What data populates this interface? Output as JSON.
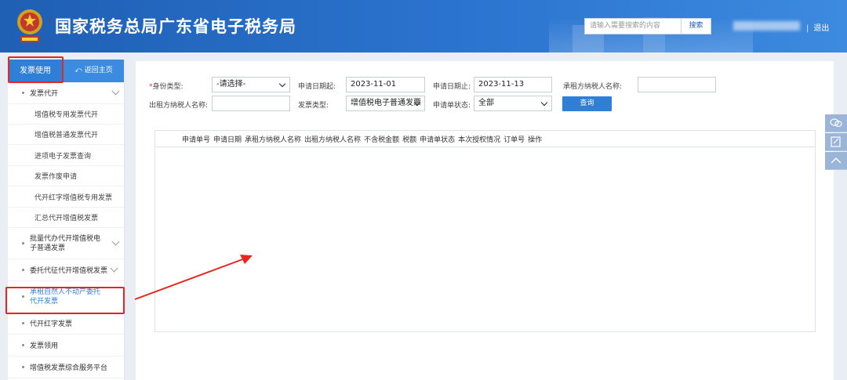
{
  "header": {
    "title": "国家税务总局广东省电子税务局",
    "search_placeholder": "请输入需要搜索的内容",
    "search_button": "搜索",
    "separator": "|",
    "logout": "退出"
  },
  "sidebar": {
    "tab_label": "发票使用",
    "home_label": "返回主页",
    "items": [
      {
        "label": "发票代开",
        "level": "top",
        "chevron": true
      },
      {
        "label": "增值税专用发票代开",
        "level": "sub"
      },
      {
        "label": "增值税普通发票代开",
        "level": "sub"
      },
      {
        "label": "进项电子发票查询",
        "level": "sub"
      },
      {
        "label": "发票作废申请",
        "level": "sub"
      },
      {
        "label": "代开红字增值税专用发票",
        "level": "sub"
      },
      {
        "label": "汇总代开增值税发票",
        "level": "sub"
      },
      {
        "label": "批量代办代开增值税电子普通发票",
        "level": "top",
        "chevron": true
      },
      {
        "label": "委托代征代开增值税发票",
        "level": "top",
        "chevron": true
      },
      {
        "label": "承租自然人不动产委托代开发票",
        "level": "top",
        "active": true
      },
      {
        "label": "代开红字发票",
        "level": "top"
      },
      {
        "label": "发票领用",
        "level": "top"
      },
      {
        "label": "增值税发票综合服务平台",
        "level": "top"
      }
    ]
  },
  "form": {
    "identity_required": "*",
    "identity_label": "身份类型:",
    "identity_value": "-请选择-",
    "apply_start_label": "申请日期起:",
    "apply_start_value": "2023-11-01",
    "apply_end_label": "申请日期止:",
    "apply_end_value": "2023-11-13",
    "lessee_label": "承租方纳税人名称:",
    "lessee_value": "",
    "lessor_label": "出租方纳税人名称:",
    "lessor_value": "",
    "invoice_type_label": "发票类型:",
    "invoice_type_value": "增值税电子普通发票",
    "status_label": "申请单状态:",
    "status_value": "全部",
    "query_button": "查询"
  },
  "table": {
    "columns": [
      "申请单号",
      "申请日期",
      "承租方纳税人名称",
      "出租方纳税人名称",
      "不含税金额",
      "税额",
      "申请单状态",
      "本次授权情况",
      "订单号",
      "操作"
    ],
    "rows": []
  },
  "colors": {
    "header_blue": "#2b74cf",
    "accent_blue": "#2f7fd6",
    "annotation_red": "#e8261f"
  },
  "icons": [
    "emblem-icon",
    "back-arrow-icon",
    "chevron-down-icon",
    "chat-icon",
    "edit-icon",
    "chevron-up-icon"
  ]
}
